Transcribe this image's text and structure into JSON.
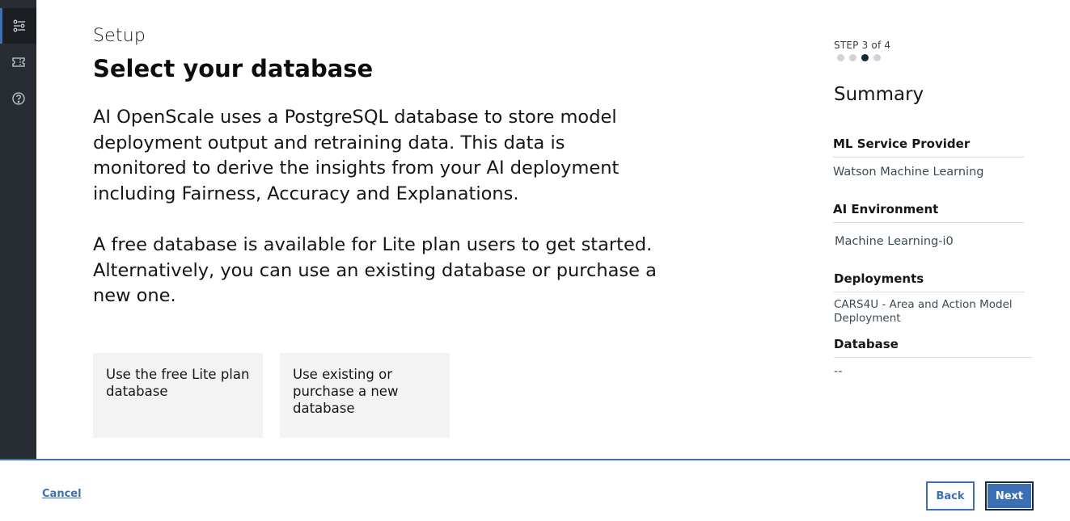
{
  "sidebar": {
    "items": [
      {
        "icon": "settings-sliders-icon",
        "active": true
      },
      {
        "icon": "ticket-icon",
        "active": false
      },
      {
        "icon": "help-icon",
        "active": false
      }
    ]
  },
  "main": {
    "section": "Setup",
    "title": "Select your database",
    "paragraph1": "AI OpenScale uses a PostgreSQL database to store model deployment output and retraining data. This data is monitored to derive the insights from your AI deployment including Fairness, Accuracy and Explanations.",
    "paragraph2": "A free database is available for Lite plan users to get started. Alternatively, you can use an existing database or purchase a new one.",
    "tiles": [
      {
        "label": "Use the free Lite plan database"
      },
      {
        "label": "Use existing or purchase a new database"
      }
    ]
  },
  "progress": {
    "label": "STEP 3 of 4",
    "current_step": 3,
    "total_steps": 4
  },
  "summary": {
    "title": "Summary",
    "items": [
      {
        "heading": "ML Service Provider",
        "value": "Watson Machine Learning"
      },
      {
        "heading": "AI Environment",
        "value": "Machine Learning-i0"
      },
      {
        "heading": "Deployments",
        "value": "CARS4U - Area and Action Model Deployment"
      },
      {
        "heading": "Database",
        "value": "--"
      }
    ]
  },
  "footer": {
    "cancel_label": "Cancel",
    "back_label": "Back",
    "next_label": "Next"
  },
  "colors": {
    "accent": "#3d70b2",
    "sidebar_bg": "#282d33",
    "tile_bg": "#f3f3f3"
  }
}
